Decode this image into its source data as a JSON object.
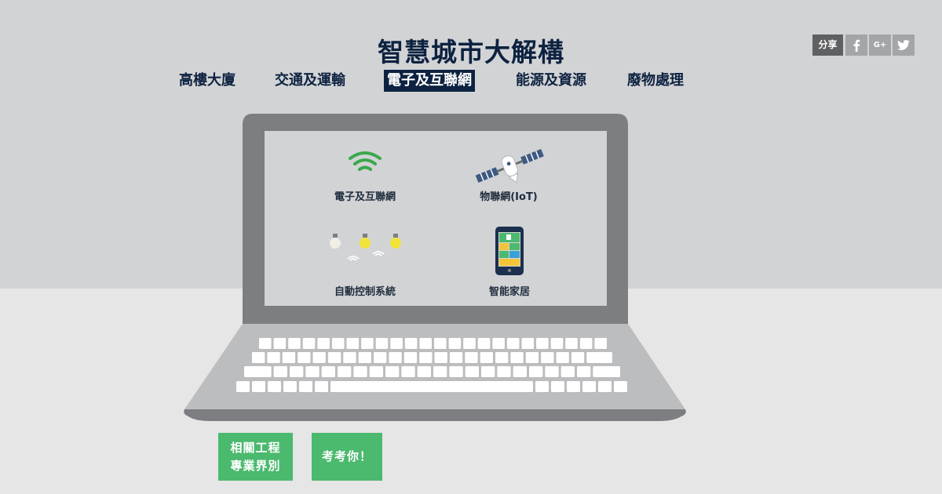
{
  "header": {
    "title": "智慧城市大解構"
  },
  "nav": {
    "items": [
      {
        "label": "高樓大廈"
      },
      {
        "label": "交通及運輸"
      },
      {
        "label": "電子及互聯網"
      },
      {
        "label": "能源及資源"
      },
      {
        "label": "廢物處理"
      }
    ],
    "active_index": 2
  },
  "share": {
    "label": "分享",
    "buttons": [
      {
        "icon": "facebook-icon"
      },
      {
        "icon": "google-plus-icon",
        "text": "G+"
      },
      {
        "icon": "twitter-icon"
      }
    ]
  },
  "screen": {
    "items": [
      {
        "label": "電子及互聯網",
        "icon": "wifi-icon"
      },
      {
        "label": "物聯網(IoT)",
        "icon": "satellite-icon"
      },
      {
        "label": "自動控制系統",
        "icon": "light-bulbs-icon"
      },
      {
        "label": "智能家居",
        "icon": "smartphone-icon"
      }
    ]
  },
  "buttons": {
    "related_line1": "相關工程",
    "related_line2": "專業界別",
    "quiz": "考考你！"
  },
  "colors": {
    "navy": "#0d2240",
    "green": "#4bb96e",
    "wifi_green": "#3aa84a",
    "bulb_yellow": "#f2e33a",
    "laptop_frame": "#7d7e82",
    "screen": "#d2d3d5"
  }
}
